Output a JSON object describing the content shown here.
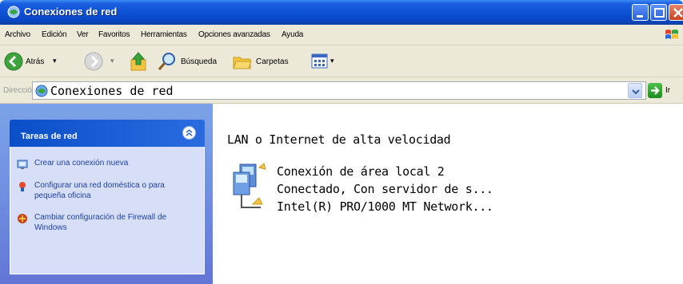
{
  "window": {
    "title": "Conexiones de red"
  },
  "menu": {
    "items": [
      "Archivo",
      "Edición",
      "Ver",
      "Favoritos",
      "Herramientas",
      "Opciones avanzadas",
      "Ayuda"
    ]
  },
  "toolbar": {
    "back_label": "Atrás",
    "search_label": "Búsqueda",
    "folders_label": "Carpetas"
  },
  "address": {
    "label": "Dirección",
    "value": "Conexiones de red",
    "go_label": "Ir"
  },
  "tasks_panel": {
    "title": "Tareas de red",
    "items": [
      {
        "label": "Crear una conexión nueva",
        "icon": "new-connection-icon"
      },
      {
        "label": "Configurar una red doméstica o para pequeña oficina",
        "icon": "home-network-icon"
      },
      {
        "label": "Cambiar configuración de Firewall de Windows",
        "icon": "firewall-icon"
      }
    ]
  },
  "content": {
    "group_header": "LAN o Internet de alta velocidad",
    "connection": {
      "name": "Conexión de área local 2",
      "status": "Conectado, Con servidor de s...",
      "device": "Intel(R) PRO/1000 MT Network..."
    }
  }
}
